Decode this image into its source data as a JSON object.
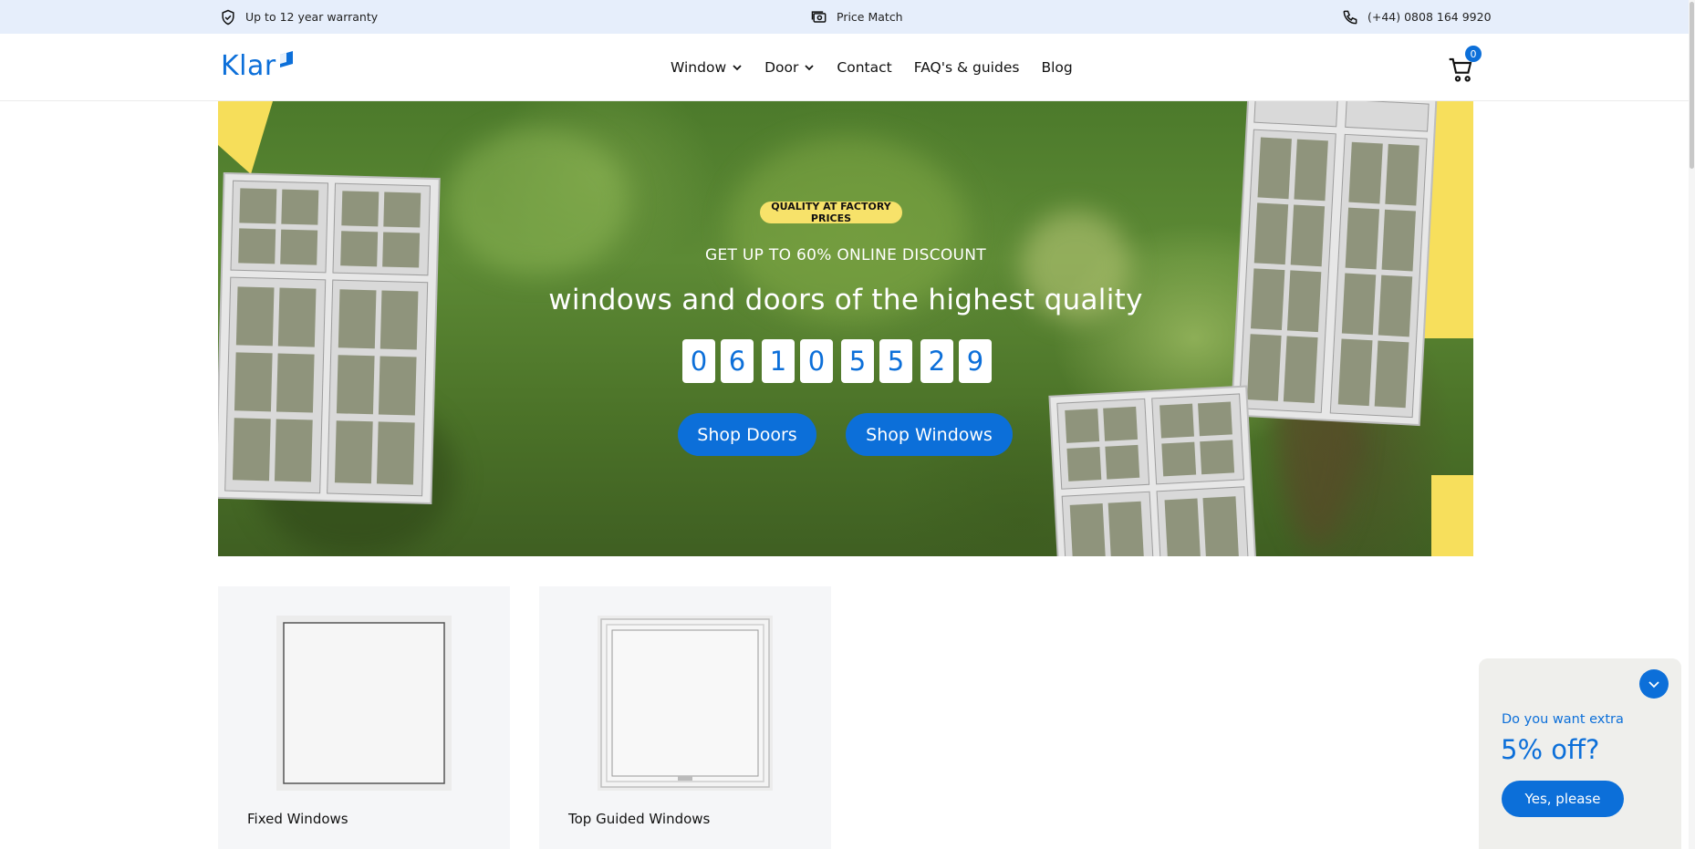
{
  "topbar": {
    "warranty": "Up to 12 year warranty",
    "price_match": "Price Match",
    "phone": "(+44) 0808 164 9920"
  },
  "header": {
    "logo_text": "Klar",
    "nav": {
      "window": "Window",
      "door": "Door",
      "contact": "Contact",
      "faq": "FAQ's & guides",
      "blog": "Blog"
    },
    "cart_count": "0"
  },
  "hero": {
    "badge": "QUALITY AT FACTORY PRICES",
    "subhead": "GET UP TO 60% ONLINE DISCOUNT",
    "headline": "windows and doors of the highest quality",
    "countdown": [
      "0",
      "6",
      "1",
      "0",
      "5",
      "5",
      "2",
      "9"
    ],
    "shop_doors": "Shop Doors",
    "shop_windows": "Shop Windows"
  },
  "products": [
    {
      "label": "Fixed Windows"
    },
    {
      "label": "Top Guided Windows"
    }
  ],
  "popup": {
    "question": "Do you want extra",
    "offer": "5% off?",
    "cta": "Yes, please"
  },
  "colors": {
    "brand_blue": "#0c6fd9",
    "topbar_bg": "#e6eefb",
    "badge_yellow": "#f7e26a"
  }
}
